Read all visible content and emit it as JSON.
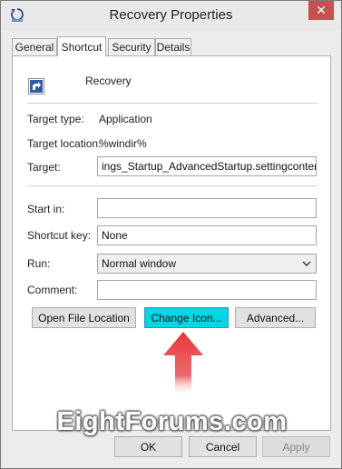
{
  "window": {
    "title": "Recovery Properties",
    "close_label": "✕"
  },
  "tabs": [
    {
      "label": "General"
    },
    {
      "label": "Shortcut"
    },
    {
      "label": "Security"
    },
    {
      "label": "Details"
    }
  ],
  "shortcut": {
    "name": "Recovery",
    "target_type_label": "Target type:",
    "target_type_value": "Application",
    "target_location_label": "Target location:",
    "target_location_value": "%windir%",
    "target_label": "Target:",
    "target_value": "ings_Startup_AdvancedStartup.settingcontent-ms",
    "start_in_label": "Start in:",
    "start_in_value": "",
    "shortcut_key_label": "Shortcut key:",
    "shortcut_key_value": "None",
    "run_label": "Run:",
    "run_value": "Normal window",
    "comment_label": "Comment:",
    "comment_value": ""
  },
  "buttons": {
    "open_file_location": "Open File Location",
    "change_icon": "Change Icon...",
    "advanced": "Advanced...",
    "ok": "OK",
    "cancel": "Cancel",
    "apply": "Apply"
  },
  "watermark": "EightForums.com",
  "colors": {
    "highlight": "#00d7e6",
    "arrow": "#e8353b",
    "close_button": "#c75050"
  }
}
